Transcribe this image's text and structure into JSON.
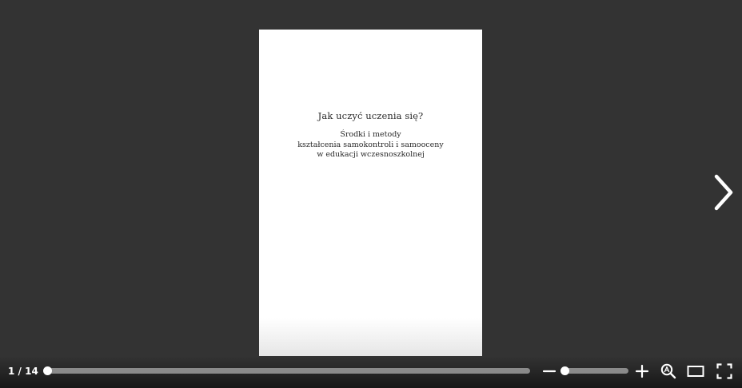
{
  "document": {
    "title": "Jak uczyć uczenia się?",
    "subtitle_lines": [
      "Środki i metody",
      "kształcenia samokontroli i samooceny",
      "w edukacji wczesnoszkolnej"
    ]
  },
  "navigation": {
    "page_counter": "1 / 14",
    "current_page": 1,
    "total_pages": 14,
    "next_icon": "chevron-right-icon"
  },
  "toolbar": {
    "zoom_level": 0.05,
    "zoom_out_icon": "minus-icon",
    "zoom_in_icon": "plus-icon",
    "search_icon": "search-text-icon",
    "single_page_icon": "single-page-view-icon",
    "fullscreen_icon": "fullscreen-icon"
  },
  "colors": {
    "background": "#333333",
    "page": "#ffffff",
    "controls": "#ffffff",
    "track": "#8a8a8a"
  }
}
